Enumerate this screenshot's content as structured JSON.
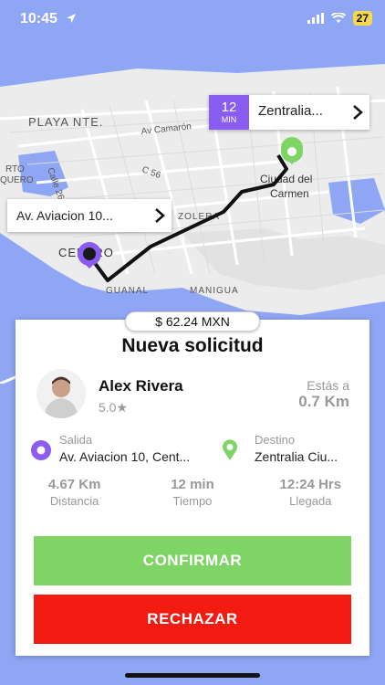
{
  "status": {
    "time": "10:45",
    "battery": "27"
  },
  "map": {
    "labels": {
      "playa": "PLAYA NTE.",
      "camaron": "Av Camarón",
      "c56": "C 56",
      "calle26": "Calle 26",
      "rto": "RTO",
      "quero": "QUERO",
      "ciudad_line1": "Ciudad del",
      "ciudad_line2": "Carmen",
      "zolera": "ZOLERA",
      "centro": "CENTRO",
      "guanal": "GUANAL",
      "manigua": "MANIGUA"
    },
    "eta": {
      "value": "12",
      "unit": "MIN"
    },
    "destination_short": "Zentralia...",
    "origin_short": "Av. Aviacion 10..."
  },
  "request": {
    "price": "$ 62.24 MXN",
    "title": "Nueva solicitud",
    "user": {
      "name": "Alex Rivera",
      "rating": "5.0"
    },
    "distance_label": "Estás a",
    "distance_value": "0.7 Km",
    "pickup": {
      "label": "Salida",
      "value": "Av. Aviacion 10, Cent..."
    },
    "dropoff": {
      "label": "Destino",
      "value": "Zentralia Ciu..."
    },
    "stats": [
      {
        "value": "4.67 Km",
        "label": "Distancia"
      },
      {
        "value": "12 min",
        "label": "Tiempo"
      },
      {
        "value": "12:24 Hrs",
        "label": "Llegada"
      }
    ],
    "confirm_label": "CONFIRMAR",
    "reject_label": "RECHAZAR"
  },
  "colors": {
    "background": "#8fa6f5",
    "accent_purple": "#8a5cf2",
    "destination_green": "#7ed465",
    "confirm": "#7ed465",
    "reject": "#f21b12"
  }
}
